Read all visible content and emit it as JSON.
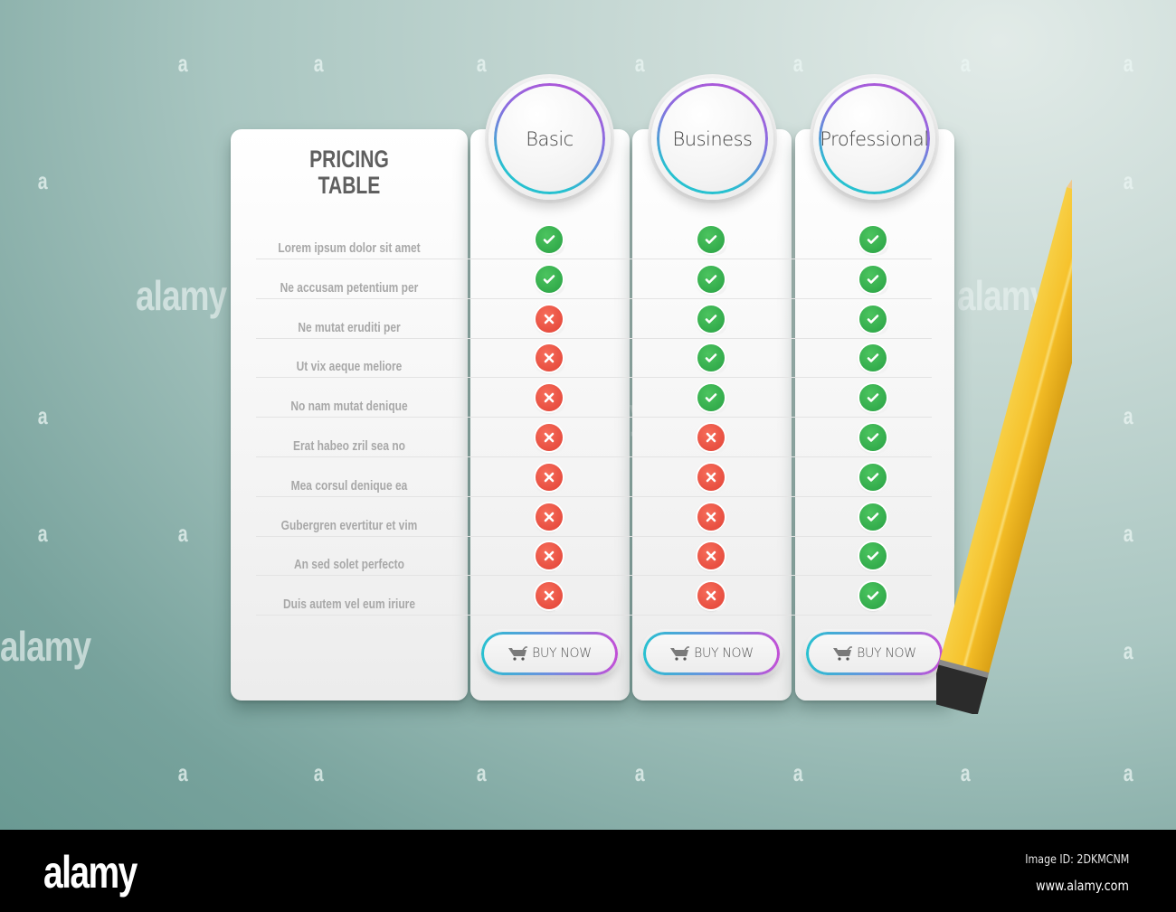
{
  "title": {
    "line1": "PRICING",
    "line2": "TABLE"
  },
  "features": [
    "Lorem ipsum dolor sit amet",
    "Ne accusam petentium per",
    "Ne mutat eruditi per",
    "Ut vix aeque meliore",
    "No nam mutat denique",
    "Erat habeo zril sea no",
    "Mea corsul denique ea",
    "Gubergren evertitur et vim",
    "An sed solet perfecto",
    "Duis autem vel eum iriure"
  ],
  "plans": [
    {
      "name": "Basic",
      "included": [
        true,
        true,
        false,
        false,
        false,
        false,
        false,
        false,
        false,
        false
      ],
      "button": "BUY NOW"
    },
    {
      "name": "Business",
      "included": [
        true,
        true,
        true,
        true,
        true,
        false,
        false,
        false,
        false,
        false
      ],
      "button": "BUY NOW"
    },
    {
      "name": "Professional",
      "included": [
        true,
        true,
        true,
        true,
        true,
        true,
        true,
        true,
        true,
        true
      ],
      "button": "BUY NOW"
    }
  ],
  "icons": {
    "included": "check-icon",
    "excluded": "cross-icon",
    "button": "cart-icon",
    "decoration": "pencil-icon"
  },
  "colors": {
    "check": "#2fa849",
    "cross": "#e64a3d",
    "ring_start": "#27c1d0",
    "ring_end": "#c24fd6",
    "title": "#5f5f5f",
    "feature_text": "#a8a8a8",
    "pencil": "#f6c12c"
  },
  "watermark": {
    "brand": "alamy",
    "letter": "a",
    "image_id": "Image ID: 2DKMCNM",
    "url": "www.alamy.com"
  }
}
